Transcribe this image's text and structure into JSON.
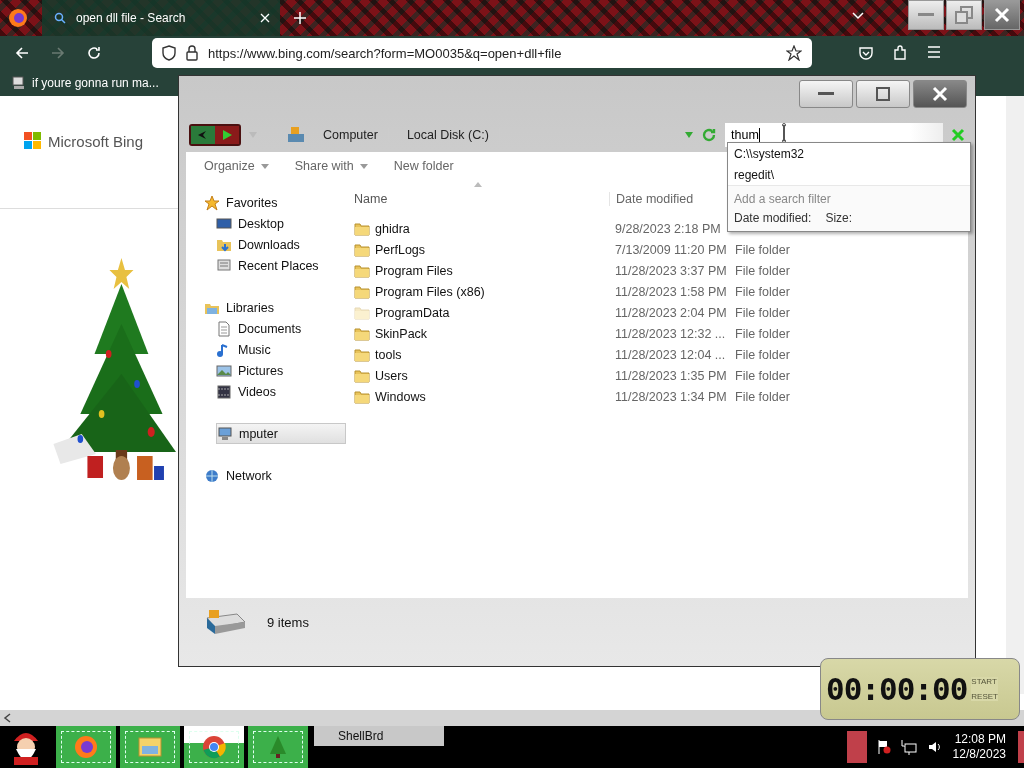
{
  "browser": {
    "tab": {
      "title": "open dll file - Search",
      "selected": true
    },
    "nav_buttons": [
      {
        "kind": "back",
        "disabled": false
      },
      {
        "kind": "forward",
        "disabled": true
      },
      {
        "kind": "reload",
        "disabled": false
      }
    ],
    "url": "https://www.bing.com/search?form=MO0035&q=open+dll+file",
    "bookmark": "if youre gonna run ma...",
    "page": {
      "logo_text": "Microsoft Bing"
    }
  },
  "explorer": {
    "breadcrumbs": [
      "Computer",
      "Local Disk (C:)"
    ],
    "search": {
      "value": "thum"
    },
    "suggestions": [
      "C:\\\\system32",
      "regedit\\"
    ],
    "filter_hint": "Add a search filter",
    "filters": [
      "Date modified:",
      "Size:"
    ],
    "commands": [
      {
        "label": "Organize",
        "menu": true
      },
      {
        "label": "Share with",
        "menu": true
      },
      {
        "label": "New folder",
        "menu": false
      }
    ],
    "nav": [
      {
        "label": "Favorites",
        "selected": false,
        "children": [
          {
            "label": "Desktop",
            "selected": false
          },
          {
            "label": "Downloads",
            "selected": false
          },
          {
            "label": "Recent Places",
            "selected": false
          }
        ]
      },
      {
        "label": "Libraries",
        "selected": false,
        "children": [
          {
            "label": "Documents",
            "selected": false
          },
          {
            "label": "Music",
            "selected": false
          },
          {
            "label": "Pictures",
            "selected": false
          },
          {
            "label": "Videos",
            "selected": false
          }
        ]
      },
      {
        "label": "mputer",
        "selected": true
      },
      {
        "label": "Network",
        "selected": false
      }
    ],
    "columns": [
      "Name",
      "Date modified"
    ],
    "rows": [
      {
        "name": "ghidra",
        "date": "9/28/2023 2:18 PM",
        "hidden": false
      },
      {
        "name": "PerfLogs",
        "date": "7/13/2009 11:20 PM",
        "type": "File folder",
        "hidden": false
      },
      {
        "name": "Program Files",
        "date": "11/28/2023 3:37 PM",
        "type": "File folder",
        "hidden": false
      },
      {
        "name": "Program Files (x86)",
        "date": "11/28/2023 1:58 PM",
        "type": "File folder",
        "hidden": false
      },
      {
        "name": "ProgramData",
        "date": "11/28/2023 2:04 PM",
        "type": "File folder",
        "hidden": true
      },
      {
        "name": "SkinPack",
        "date": "11/28/2023 12:32 ...",
        "type": "File folder",
        "hidden": false
      },
      {
        "name": "tools",
        "date": "11/28/2023 12:04 ...",
        "type": "File folder",
        "hidden": false
      },
      {
        "name": "Users",
        "date": "11/28/2023 1:35 PM",
        "type": "File folder",
        "hidden": false
      },
      {
        "name": "Windows",
        "date": "11/28/2023 1:34 PM",
        "type": "File folder",
        "hidden": false
      }
    ],
    "status": "9 items"
  },
  "timer": {
    "display": "00:00:00",
    "start_label": "START",
    "reset_label": "RESET"
  },
  "taskbar": {
    "apps": [
      {
        "kind": "firefox"
      },
      {
        "kind": "explorer"
      },
      {
        "kind": "chrome"
      },
      {
        "kind": "tree"
      }
    ],
    "task": "ShellBrd",
    "time": "12:08 PM",
    "date": "12/8/2023"
  }
}
